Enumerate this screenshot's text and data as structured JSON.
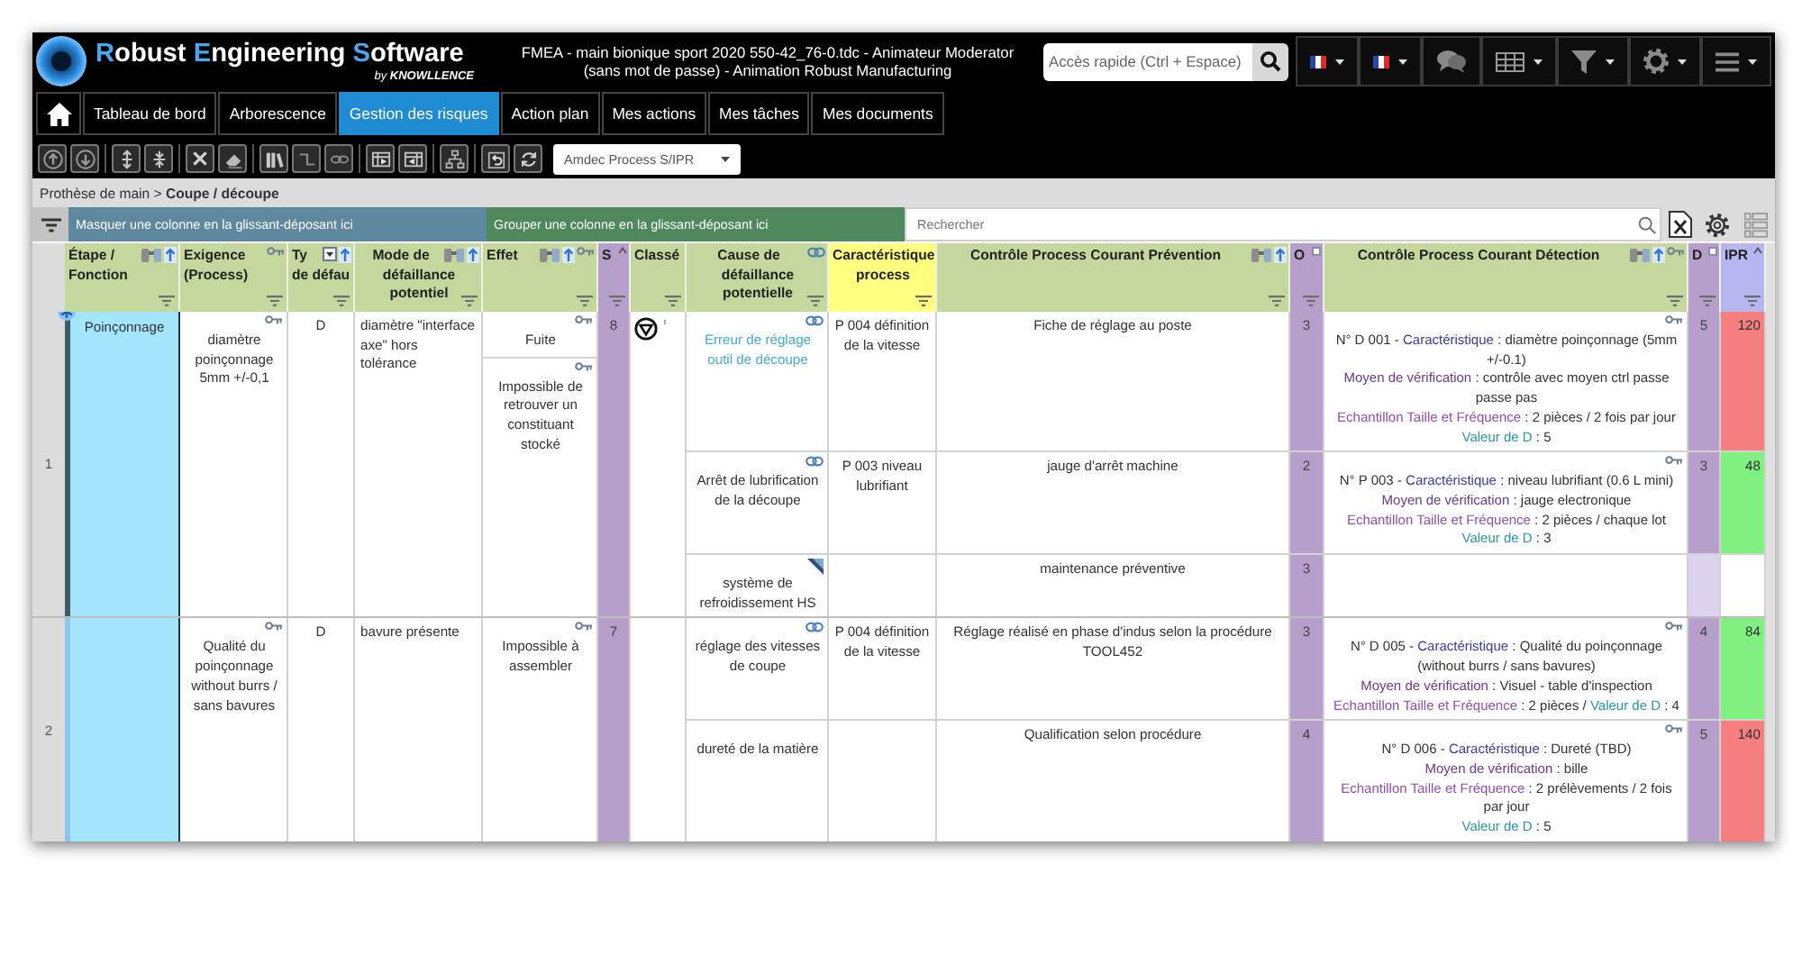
{
  "header": {
    "brand": "Robust Engineering Software",
    "vendor": "by **KNOWLLENCE**",
    "title": "FMEA - main bionique sport 2020 550-42_76-0.tdc - Animateur Moderator (sans mot de passe) - Animation Robust Manufacturing",
    "quick_search": {
      "placeholder": "Accès rapide (Ctrl + Espace)"
    }
  },
  "nav": {
    "tabs": [
      {
        "label": "Tableau de bord",
        "selected": false
      },
      {
        "label": "Arborescence",
        "selected": false
      },
      {
        "label": "Gestion des risques",
        "selected": true
      },
      {
        "label": "Action plan",
        "selected": false
      },
      {
        "label": "Mes actions",
        "selected": false
      },
      {
        "label": "Mes tâches",
        "selected": false
      },
      {
        "label": "Mes documents",
        "selected": false
      }
    ]
  },
  "toolbar": {
    "view_select": "Amdec Process S/IPR"
  },
  "breadcrumb": "Prothèse de main > **Coupe / découpe**",
  "grid": {
    "hide_zone": "Masquer une colonne en la glissant-déposant ici",
    "group_zone": "Grouper une colonne en la glissant-déposant ici",
    "search": {
      "placeholder": "Rechercher"
    },
    "columns": [
      {
        "label": "Étape / Fonction",
        "kind": "text"
      },
      {
        "label": "Exigence (Process)",
        "kind": "text"
      },
      {
        "label": "Ty de défau",
        "kind": "text"
      },
      {
        "label": "Mode de défaillance potentiel",
        "kind": "text"
      },
      {
        "label": "Effet",
        "kind": "text"
      },
      {
        "label": "S",
        "kind": "rating"
      },
      {
        "label": "Classé",
        "kind": "text"
      },
      {
        "label": "Cause de défaillance potentielle",
        "kind": "text"
      },
      {
        "label": "Caractéristique process",
        "kind": "characteristic"
      },
      {
        "label": "Contrôle Process Courant Prévention",
        "kind": "text"
      },
      {
        "label": "O",
        "kind": "rating"
      },
      {
        "label": "Contrôle Process Courant Détection",
        "kind": "text"
      },
      {
        "label": "D",
        "kind": "rating"
      },
      {
        "label": "IPR",
        "kind": "priority"
      }
    ],
    "rows": [
      {
        "number": "1",
        "selected": true,
        "step": "Poinçonnage",
        "requirement": "diamètre poinçonnage 5mm +/-0,1",
        "type": "D",
        "failure_mode": "diamètre \"interface axe\" hors tolérance",
        "effects": [
          "Fuite",
          "Impossible de retrouver un constituant stocké"
        ],
        "severity": "8",
        "classified": true,
        "causes": [
          {
            "cause": "Erreur de réglage outil de découpe",
            "highlighted": true,
            "linked": true,
            "annotated": false,
            "characteristic": "P 004 définition de la vitesse",
            "prevention": "Fiche de réglage au poste",
            "occurrence": "3",
            "detection": [
              [
                {
                  "text": "N° D 001 - ",
                  "kind": "text"
                },
                {
                  "text": "Caractéristique",
                  "kind": "characteristic"
                },
                {
                  "text": " : diamètre poinçonnage (5mm +/-0.1)",
                  "kind": "text"
                }
              ],
              [
                {
                  "text": "Moyen de vérification",
                  "kind": "method"
                },
                {
                  "text": " : contrôle avec moyen ctrl passe passe pas",
                  "kind": "text"
                }
              ],
              [
                {
                  "text": "Echantillon Taille et Fréquence",
                  "kind": "sampling"
                },
                {
                  "text": " : 2 pièces / 2 fois par jour",
                  "kind": "text"
                }
              ],
              [
                {
                  "text": "Valeur de D",
                  "kind": "rating"
                },
                {
                  "text": " : 5",
                  "kind": "text"
                }
              ]
            ],
            "detection_rating": "5",
            "priority": {
              "value": "120",
              "color": "#f67f7f"
            }
          },
          {
            "cause": "Arrêt de lubrification de la découpe",
            "highlighted": false,
            "linked": true,
            "annotated": false,
            "characteristic": "P 003 niveau lubrifiant",
            "prevention": "jauge d'arrêt machine",
            "occurrence": "2",
            "detection": [
              [
                {
                  "text": "N° P 003 - ",
                  "kind": "text"
                },
                {
                  "text": "Caractéristique",
                  "kind": "characteristic"
                },
                {
                  "text": " : niveau lubrifiant (0.6 L mini)",
                  "kind": "text"
                }
              ],
              [
                {
                  "text": "Moyen de vérification",
                  "kind": "method"
                },
                {
                  "text": " : jauge electronique",
                  "kind": "text"
                }
              ],
              [
                {
                  "text": "Echantillon Taille et Fréquence",
                  "kind": "sampling"
                },
                {
                  "text": " : 2 pièces / chaque lot",
                  "kind": "text"
                }
              ],
              [
                {
                  "text": "Valeur de D",
                  "kind": "rating"
                },
                {
                  "text": " : 3",
                  "kind": "text"
                }
              ]
            ],
            "detection_rating": "3",
            "priority": {
              "value": "48",
              "color": "#80f080"
            }
          },
          {
            "cause": "système de refroidissement HS",
            "highlighted": false,
            "linked": false,
            "annotated": true,
            "prevention": "maintenance préventive",
            "occurrence": "3"
          }
        ]
      },
      {
        "number": "2",
        "selected": false,
        "requirement": "Qualité du poinçonnage without burrs / sans bavures",
        "type": "D",
        "failure_mode": "bavure présente",
        "effects": [
          "Impossible à assembler"
        ],
        "severity": "7",
        "classified": false,
        "causes": [
          {
            "cause": "réglage des vitesses de coupe",
            "highlighted": false,
            "linked": true,
            "annotated": false,
            "characteristic": "P 004 définition de la vitesse",
            "prevention": "Réglage réalisé en phase d'indus selon la procédure TOOL452",
            "occurrence": "3",
            "detection": [
              [
                {
                  "text": "N° D 005 - ",
                  "kind": "text"
                },
                {
                  "text": "Caractéristique",
                  "kind": "characteristic"
                },
                {
                  "text": " : Qualité du poinçonnage (without burrs / sans bavures)",
                  "kind": "text"
                }
              ],
              [
                {
                  "text": "Moyen de vérification",
                  "kind": "method"
                },
                {
                  "text": " : Visuel - table d'inspection",
                  "kind": "text"
                }
              ],
              [
                {
                  "text": "Echantillon Taille et Fréquence",
                  "kind": "sampling"
                },
                {
                  "text": " : 2 pièces / ",
                  "kind": "text"
                },
                {
                  "text": "Valeur de D",
                  "kind": "rating"
                },
                {
                  "text": " : 4",
                  "kind": "text"
                }
              ]
            ],
            "detection_rating": "4",
            "priority": {
              "value": "84",
              "color": "#80f080"
            }
          },
          {
            "cause": "dureté de la matière",
            "highlighted": false,
            "linked": false,
            "annotated": false,
            "prevention": "Qualification selon procédure",
            "occurrence": "4",
            "detection": [
              [
                {
                  "text": "N° D 006 - ",
                  "kind": "text"
                },
                {
                  "text": "Caractéristique",
                  "kind": "characteristic"
                },
                {
                  "text": " : Dureté (TBD)",
                  "kind": "text"
                }
              ],
              [
                {
                  "text": "Moyen de vérification",
                  "kind": "method"
                },
                {
                  "text": " : bille",
                  "kind": "text"
                }
              ],
              [
                {
                  "text": "Echantillon Taille et Fréquence",
                  "kind": "sampling"
                },
                {
                  "text": " : 2 prélèvements / 2 fois par jour",
                  "kind": "text"
                }
              ],
              [
                {
                  "text": "Valeur de D",
                  "kind": "rating"
                },
                {
                  "text": " : 5",
                  "kind": "text"
                }
              ]
            ],
            "detection_rating": "5",
            "priority": {
              "value": "140",
              "color": "#f67f7f"
            }
          }
        ]
      }
    ]
  }
}
